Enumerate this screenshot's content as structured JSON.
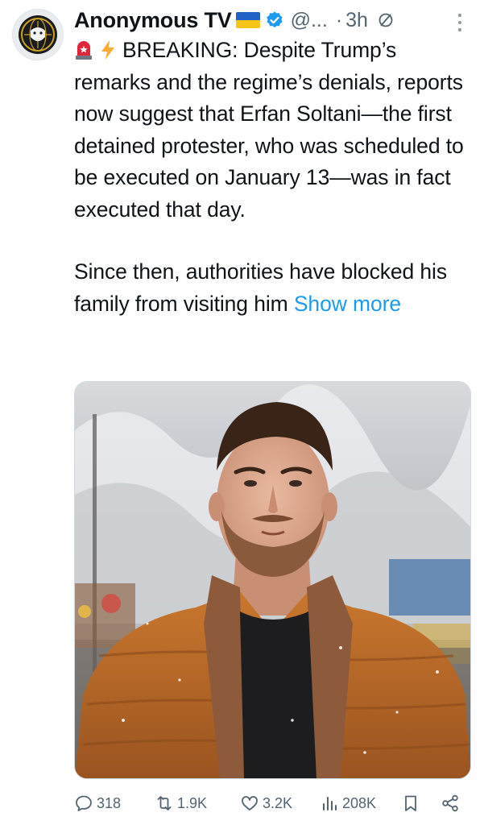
{
  "author": {
    "display_name": "Anonymous TV",
    "handle": "@...",
    "separator": "·",
    "time": "3h",
    "badges": [
      "ukraine-flag-icon",
      "verified-icon"
    ],
    "avatar_icon": "anonymous-mask-logo"
  },
  "tweet": {
    "lead_emojis": [
      "siren-icon",
      "lightning-icon"
    ],
    "paragraph1": "BREAKING: Despite Trump’s remarks and the regime’s denials, reports now suggest that Erfan Soltani—the first detained protester, who was scheduled to be executed on January 13—was in fact executed that day.",
    "paragraph2": "Since then, authorities have blocked his family from visiting him",
    "show_more": "Show more"
  },
  "media": {
    "type": "photo"
  },
  "actions": {
    "replies": "318",
    "reposts": "1.9K",
    "likes": "3.2K",
    "views": "208K",
    "icons": [
      "reply-icon",
      "repost-icon",
      "like-icon",
      "views-icon",
      "bookmark-icon",
      "share-icon"
    ]
  },
  "colors": {
    "text": "#0f1419",
    "secondary": "#536471",
    "link": "#1d9bf0",
    "verified": "#1d9bf0"
  }
}
